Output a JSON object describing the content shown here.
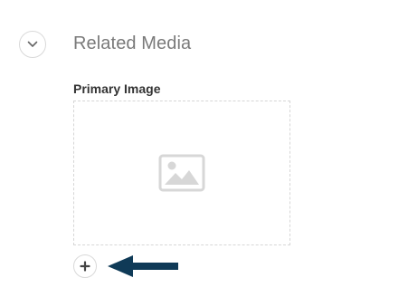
{
  "section": {
    "title": "Related Media",
    "toggle_icon": "chevron-down-icon"
  },
  "field": {
    "label": "Primary Image",
    "placeholder_icon": "image-placeholder-icon",
    "add_icon": "plus-icon"
  },
  "annotation": {
    "icon": "arrow-left-icon",
    "color": "#0f3a57"
  },
  "colors": {
    "title": "#7a7a7a",
    "label": "#333333",
    "border": "#d9d9d9",
    "placeholder": "#d7d7d7"
  }
}
